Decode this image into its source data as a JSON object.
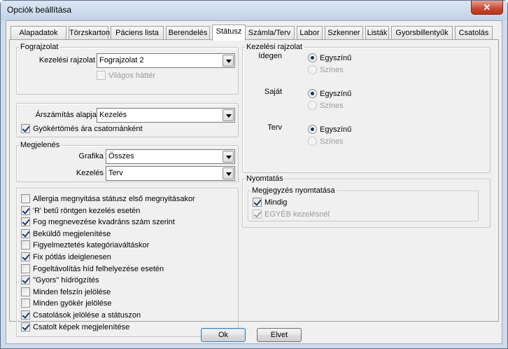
{
  "window": {
    "title": "Opciók beállítása",
    "close_glyph": "✕"
  },
  "tabs": [
    {
      "label": "Alapadatok",
      "active": false
    },
    {
      "label": "Törzskarton",
      "active": false
    },
    {
      "label": "Páciens lista",
      "active": false
    },
    {
      "label": "Berendelés",
      "active": false
    },
    {
      "label": "Státusz",
      "active": true
    },
    {
      "label": "Számla/Terv",
      "active": false
    },
    {
      "label": "Labor",
      "active": false
    },
    {
      "label": "Szkenner",
      "active": false
    },
    {
      "label": "Listák",
      "active": false
    },
    {
      "label": "Gyorsbillentyűk",
      "active": false
    },
    {
      "label": "Csatolás",
      "active": false
    }
  ],
  "fograjzolat": {
    "group_title": "Fograjzolat",
    "kezelesi_label": "Kezelési rajzolat",
    "kezelesi_value": "Fograjzolat 2",
    "vilagos_label": "Világos háttér",
    "vilagos_checked": false
  },
  "arszamitas": {
    "label": "Árszámítás alapja",
    "value": "Kezelés",
    "gyoker_label": "Gyökértömés ára csatornánként",
    "gyoker_checked": true
  },
  "megjelenes": {
    "group_title": "Megjelenés",
    "grafika_label": "Grafika",
    "grafika_value": "Összes",
    "kezeles_label": "Kezelés",
    "kezeles_value": "Terv"
  },
  "options": [
    {
      "label": "Allergia megnyitása státusz első megnyitásakor",
      "checked": false
    },
    {
      "label": "'R' betű röntgen kezelés esetén",
      "checked": true
    },
    {
      "label": "Fog megnevezése kvadráns szám szerint",
      "checked": true
    },
    {
      "label": "Beküldő megjelenítése",
      "checked": true
    },
    {
      "label": "Figyelmeztetés kategóriaváltáskor",
      "checked": false
    },
    {
      "label": "Fix pótlás ideiglenesen",
      "checked": true
    },
    {
      "label": "Fogeltávolítás híd felhelyezése esetén",
      "checked": false
    },
    {
      "label": "\"Gyors\" hídrögzítés",
      "checked": true
    },
    {
      "label": "Minden felszín jelölése",
      "checked": false
    },
    {
      "label": "Minden gyökér jelölése",
      "checked": false
    },
    {
      "label": "Csatolások jelölése a státuszon",
      "checked": true
    },
    {
      "label": "Csatolt képek megjelenítése",
      "checked": true
    }
  ],
  "kezelesi_rajzolat": {
    "group_title": "Kezelési rajzolat",
    "rows": [
      {
        "label": "Idegen",
        "opt1": "Egyszínű",
        "opt2": "Színes",
        "selected": 1
      },
      {
        "label": "Saját",
        "opt1": "Egyszínű",
        "opt2": "Színes",
        "selected": 1
      },
      {
        "label": "Terv",
        "opt1": "Egyszínű",
        "opt2": "Színes",
        "selected": 1
      }
    ]
  },
  "nyomtatas": {
    "group_title": "Nyomtatás",
    "sub_title": "Megjegyzés nyomtatása",
    "mindig_label": "Mindig",
    "mindig_checked": true,
    "egyeb_label": "EGYÉB kezelésnél",
    "egyeb_checked": true
  },
  "buttons": {
    "ok": "Ok",
    "cancel": "Elvet"
  }
}
